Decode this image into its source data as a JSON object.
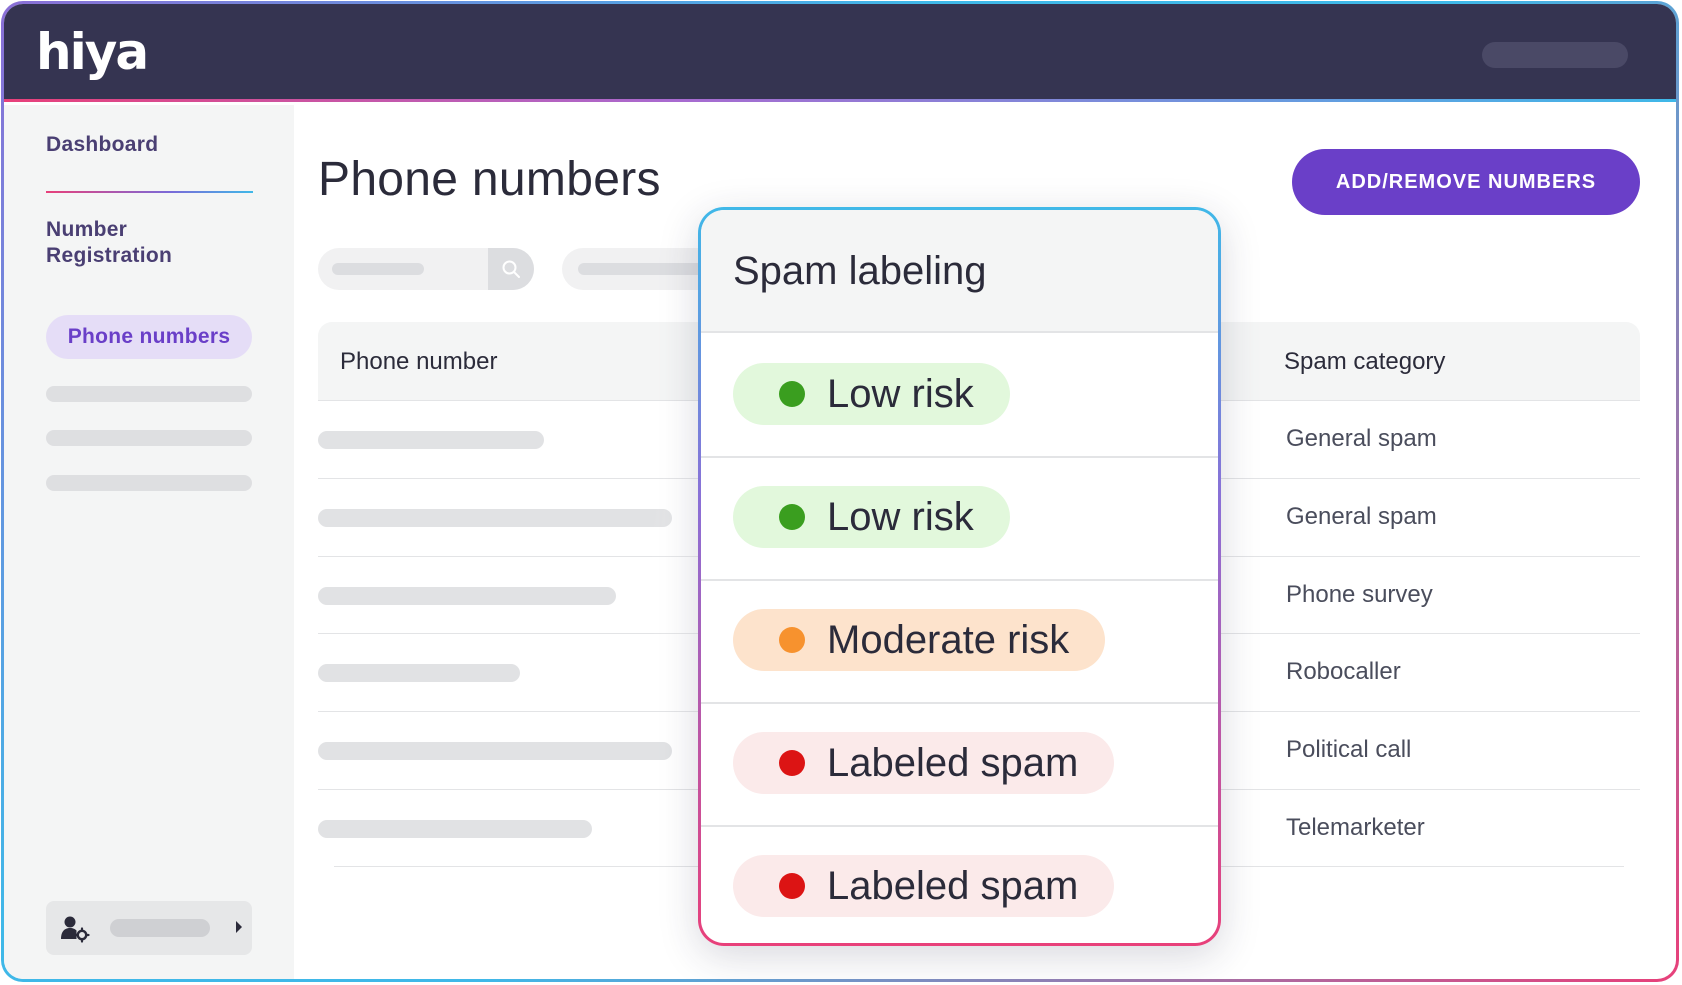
{
  "header": {
    "logo_text": "hiya"
  },
  "sidebar": {
    "dashboard": "Dashboard",
    "number_registration": "Number Registration",
    "active_item": "Phone numbers",
    "user_icon": "user-settings-icon"
  },
  "main": {
    "title": "Phone numbers",
    "primary_button": "ADD/REMOVE NUMBERS",
    "search_icon": "search-icon",
    "table": {
      "columns": [
        "Phone number",
        "Spam category"
      ],
      "spam_categories": [
        "General spam",
        "General spam",
        "Phone survey",
        "Robocaller",
        "Political call",
        "Telemarketer"
      ]
    }
  },
  "popup": {
    "title": "Spam labeling",
    "items": [
      {
        "label": "Low risk",
        "status": "low",
        "dot_color": "#3a9e1f",
        "bg_color": "#e2f8dc"
      },
      {
        "label": "Low risk",
        "status": "low",
        "dot_color": "#3a9e1f",
        "bg_color": "#e2f8dc"
      },
      {
        "label": "Moderate risk",
        "status": "moderate",
        "dot_color": "#f7922e",
        "bg_color": "#fde3cc"
      },
      {
        "label": "Labeled spam",
        "status": "spam",
        "dot_color": "#dc1414",
        "bg_color": "#fbeaea"
      },
      {
        "label": "Labeled spam",
        "status": "spam",
        "dot_color": "#dc1414",
        "bg_color": "#fbeaea"
      }
    ]
  },
  "colors": {
    "header_bg": "#353451",
    "accent_purple": "#6a3fc8",
    "active_nav_bg": "#e5ddf7"
  }
}
